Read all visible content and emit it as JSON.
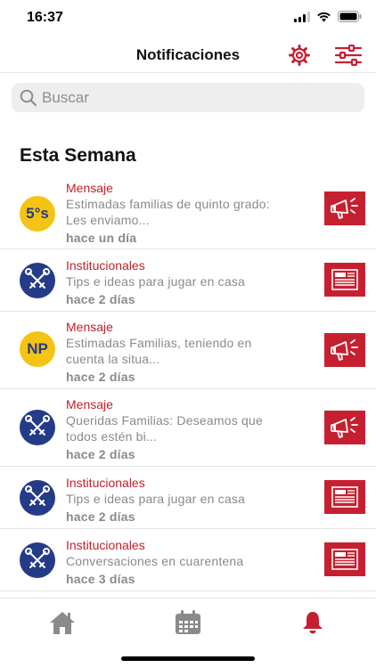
{
  "status": {
    "time": "16:37"
  },
  "nav": {
    "title": "Notificaciones"
  },
  "search": {
    "placeholder": "Buscar"
  },
  "section": {
    "title": "Esta Semana"
  },
  "items": [
    {
      "category": "Mensaje",
      "line1": "Estimadas familias de quinto grado:",
      "line2": "Les enviamo...",
      "time": "hace un día",
      "avatar": "5°s",
      "icon": "megaphone-icon"
    },
    {
      "category": "Institucionales",
      "line1": "Tips e ideas para jugar en casa",
      "line2": "",
      "time": "hace 2 días",
      "avatar": "keys-logo",
      "icon": "news-icon"
    },
    {
      "category": "Mensaje",
      "line1": "Estimadas Familias,  teniendo en",
      "line2": "cuenta la situa...",
      "time": "hace 2 días",
      "avatar": "NP",
      "icon": "megaphone-icon"
    },
    {
      "category": "Mensaje",
      "line1": "Queridas Familias:  Deseamos que",
      "line2": "todos estén bi...",
      "time": "hace 2 días",
      "avatar": "keys-logo",
      "icon": "megaphone-icon"
    },
    {
      "category": "Institucionales",
      "line1": "Tips e ideas para jugar en casa",
      "line2": "",
      "time": "hace 2 días",
      "avatar": "keys-logo",
      "icon": "news-icon"
    },
    {
      "category": "Institucionales",
      "line1": "Conversaciones en cuarentena",
      "line2": "",
      "time": "hace 3 días",
      "avatar": "keys-logo",
      "icon": "news-icon"
    }
  ],
  "tabs": [
    {
      "name": "home-icon",
      "active": false
    },
    {
      "name": "calendar-icon",
      "active": false
    },
    {
      "name": "bell-icon",
      "active": true
    }
  ],
  "colors": {
    "accent": "#c62030",
    "navy": "#243b88",
    "yellow": "#f4c414",
    "tab_inactive": "#8a8a8a"
  }
}
